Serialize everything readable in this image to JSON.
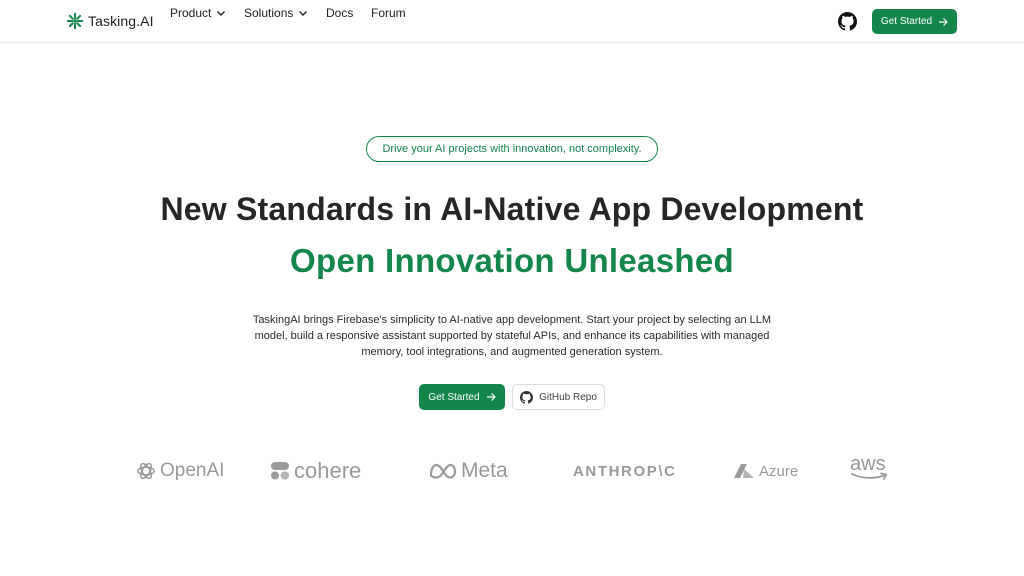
{
  "nav": {
    "brand": "Tasking.AI",
    "menu": [
      {
        "label": "Product"
      },
      {
        "label": "Solutions"
      },
      {
        "label": "Docs"
      },
      {
        "label": "Forum"
      }
    ],
    "cta_label": "Get Started"
  },
  "hero": {
    "pill": "Drive your AI projects with innovation, not complexity.",
    "headline": "New Standards in AI-Native App Development",
    "subheadline": "Open Innovation Unleashed",
    "description": "TaskingAI brings Firebase's simplicity to AI-native app development. Start your project by selecting an LLM model, build a responsive assistant supported by stateful APIs, and enhance its capabilities with managed memory, tool integrations, and augmented generation system.",
    "primary_cta": "Get Started",
    "secondary_cta": "GitHub Repo"
  },
  "partners": {
    "openai": "OpenAI",
    "cohere": "cohere",
    "meta": "Meta",
    "anthropic": "ANTHROP\\C",
    "azure": "Azure",
    "aws": "aws"
  },
  "colors": {
    "accent": "#14864c",
    "logo_gray": "#9a9a9a"
  }
}
